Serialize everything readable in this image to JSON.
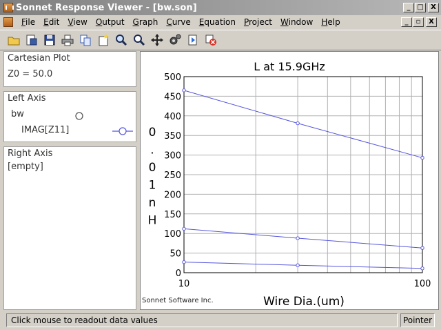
{
  "window": {
    "title": "Sonnet Response Viewer - [bw.son]",
    "minimize": "_",
    "maximize": "□",
    "close": "X",
    "restore": "▫"
  },
  "menu": [
    "File",
    "Edit",
    "View",
    "Output",
    "Graph",
    "Curve",
    "Equation",
    "Project",
    "Window",
    "Help"
  ],
  "toolbar": [
    "open-icon",
    "save-as-icon",
    "save-icon",
    "print-icon",
    "copy-icon",
    "new-icon",
    "zoom-in-icon",
    "zoom-out-icon",
    "pan-icon",
    "settings-icon",
    "refresh-icon",
    "stop-icon"
  ],
  "left_panel": {
    "plot_type": "Cartesian Plot",
    "z0": "Z0 = 50.0",
    "left_axis_title": "Left Axis",
    "project_name": "bw",
    "curve_name": "IMAG[Z11]",
    "right_axis_title": "Right Axis",
    "right_axis_value": "[empty]"
  },
  "chart_data": {
    "type": "line",
    "title": "L at 15.9GHz",
    "xlabel": "Wire Dia.(um)",
    "ylabel": "0.01nH",
    "xscale": "log",
    "xlim": [
      10,
      100
    ],
    "ylim": [
      0,
      500
    ],
    "xticks": [
      "10",
      "100"
    ],
    "yticks": [
      "0",
      "50",
      "100",
      "150",
      "200",
      "250",
      "300",
      "350",
      "400",
      "450",
      "500"
    ],
    "grid": true,
    "series": [
      {
        "x": [
          10,
          30,
          100
        ],
        "values": [
          465,
          381,
          293
        ]
      },
      {
        "x": [
          10,
          30,
          100
        ],
        "values": [
          112,
          88,
          63
        ]
      },
      {
        "x": [
          10,
          30,
          100
        ],
        "values": [
          27,
          19,
          11
        ]
      }
    ],
    "line_color": "#5555dd",
    "footer": "Sonnet Software Inc."
  },
  "status": {
    "message": "Click mouse to readout data values",
    "mode": "Pointer"
  }
}
